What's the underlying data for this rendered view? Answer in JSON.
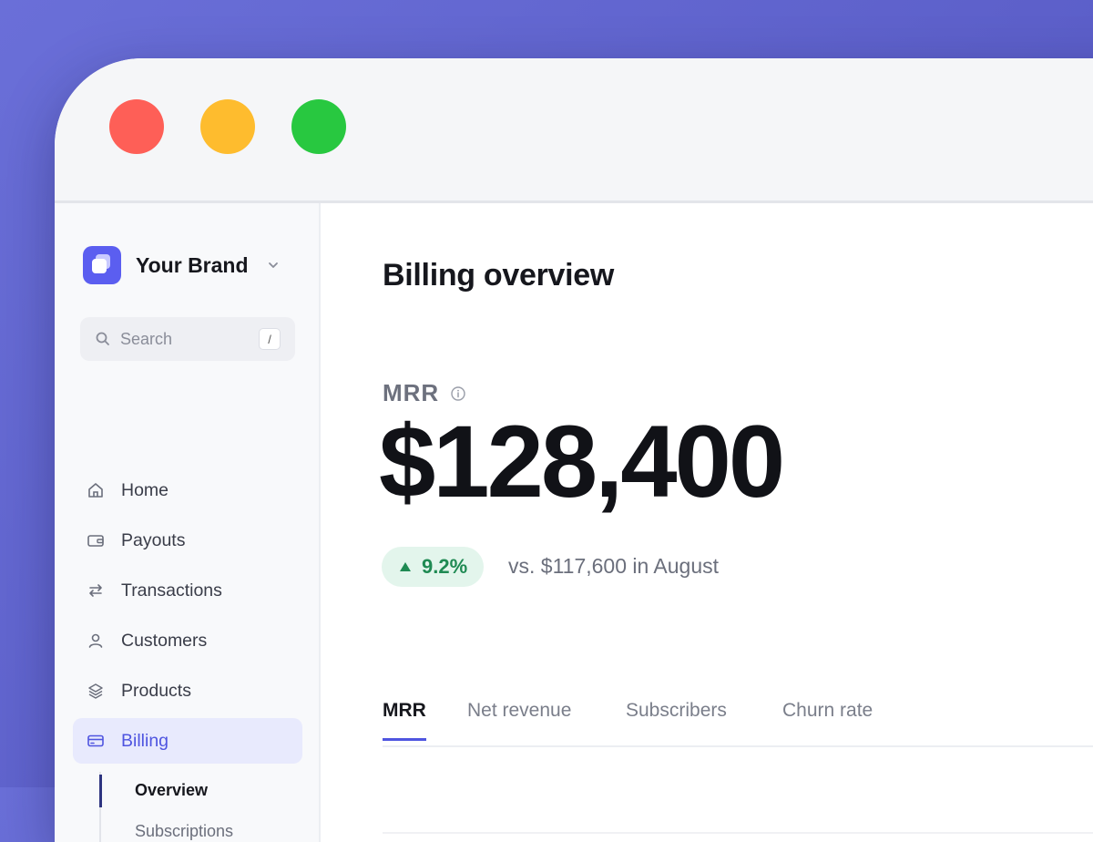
{
  "window": {
    "controls": [
      "close",
      "minimize",
      "maximize"
    ]
  },
  "colors": {
    "accent": "#4f55e0",
    "positive": "#1f8a53",
    "brand_logo": "#5b5ef0"
  },
  "sidebar": {
    "brand_name": "Your Brand",
    "search": {
      "placeholder": "Search",
      "shortcut": "/"
    },
    "items": [
      {
        "label": "Home",
        "icon": "home-icon"
      },
      {
        "label": "Payouts",
        "icon": "wallet-icon"
      },
      {
        "label": "Transactions",
        "icon": "arrows-swap-icon"
      },
      {
        "label": "Customers",
        "icon": "user-icon"
      },
      {
        "label": "Products",
        "icon": "layers-icon"
      },
      {
        "label": "Billing",
        "icon": "credit-card-icon",
        "active": true
      }
    ],
    "subitems": [
      {
        "label": "Overview",
        "active": true
      },
      {
        "label": "Subscriptions"
      }
    ]
  },
  "main": {
    "title": "Billing overview",
    "metric": {
      "label": "MRR",
      "value": "$128,400",
      "change": "9.2%",
      "comparison": "vs. $117,600 in August"
    },
    "tabs": [
      {
        "label": "MRR",
        "active": true
      },
      {
        "label": "Net revenue"
      },
      {
        "label": "Subscribers"
      },
      {
        "label": "Churn rate"
      }
    ]
  }
}
